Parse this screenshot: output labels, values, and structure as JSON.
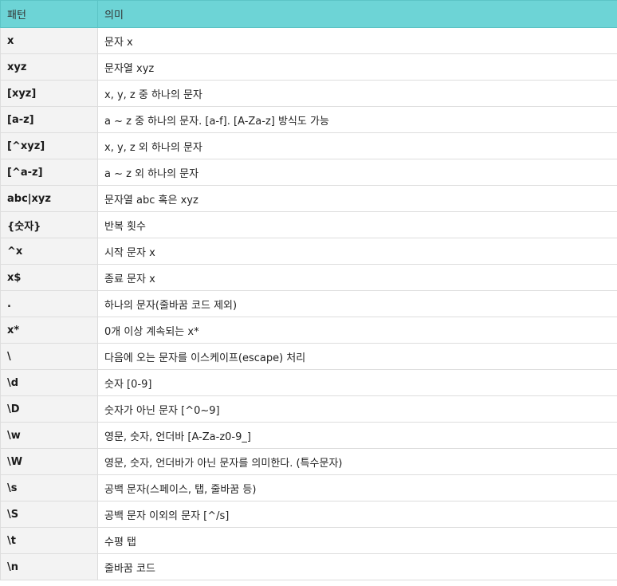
{
  "table": {
    "headers": [
      "패턴",
      "의미"
    ],
    "rows": [
      [
        "x",
        "문자 x"
      ],
      [
        "xyz",
        "문자열 xyz"
      ],
      [
        "[xyz]",
        "x, y, z 중 하나의 문자"
      ],
      [
        "[a-z]",
        "a ~ z 중 하나의 문자. [a-f]. [A-Za-z] 방식도 가능"
      ],
      [
        "[^xyz]",
        "x, y, z 외 하나의 문자"
      ],
      [
        "[^a-z]",
        "a ~ z 외 하나의 문자"
      ],
      [
        "abc|xyz",
        "문자열 abc 혹은 xyz"
      ],
      [
        "{숫자}",
        "반복 횟수"
      ],
      [
        "^x",
        "시작 문자 x"
      ],
      [
        "x$",
        "종료 문자 x"
      ],
      [
        ".",
        "하나의 문자(줄바꿈 코드 제외)"
      ],
      [
        "x*",
        "0개 이상 계속되는 x*"
      ],
      [
        "\\",
        "다음에 오는 문자를 이스케이프(escape) 처리"
      ],
      [
        "\\d",
        "숫자 [0-9]"
      ],
      [
        "\\D",
        "숫자가 아닌 문자 [^0~9]"
      ],
      [
        "\\w",
        "영문, 숫자, 언더바 [A-Za-z0-9_]"
      ],
      [
        "\\W",
        "영문, 숫자, 언더바가 아닌 문자를 의미한다. (특수문자)"
      ],
      [
        "\\s",
        "공백 문자(스페이스, 탭, 줄바꿈 등)"
      ],
      [
        "\\S",
        "공백 문자 이외의 문자 [^/s]"
      ],
      [
        "\\t",
        "수평 탭"
      ],
      [
        "\\n",
        "줄바꿈 코드"
      ]
    ]
  },
  "colors": {
    "header_bg": "#6dd4d6",
    "pattern_cell_bg": "#f3f3f3",
    "border": "#dddddd"
  }
}
